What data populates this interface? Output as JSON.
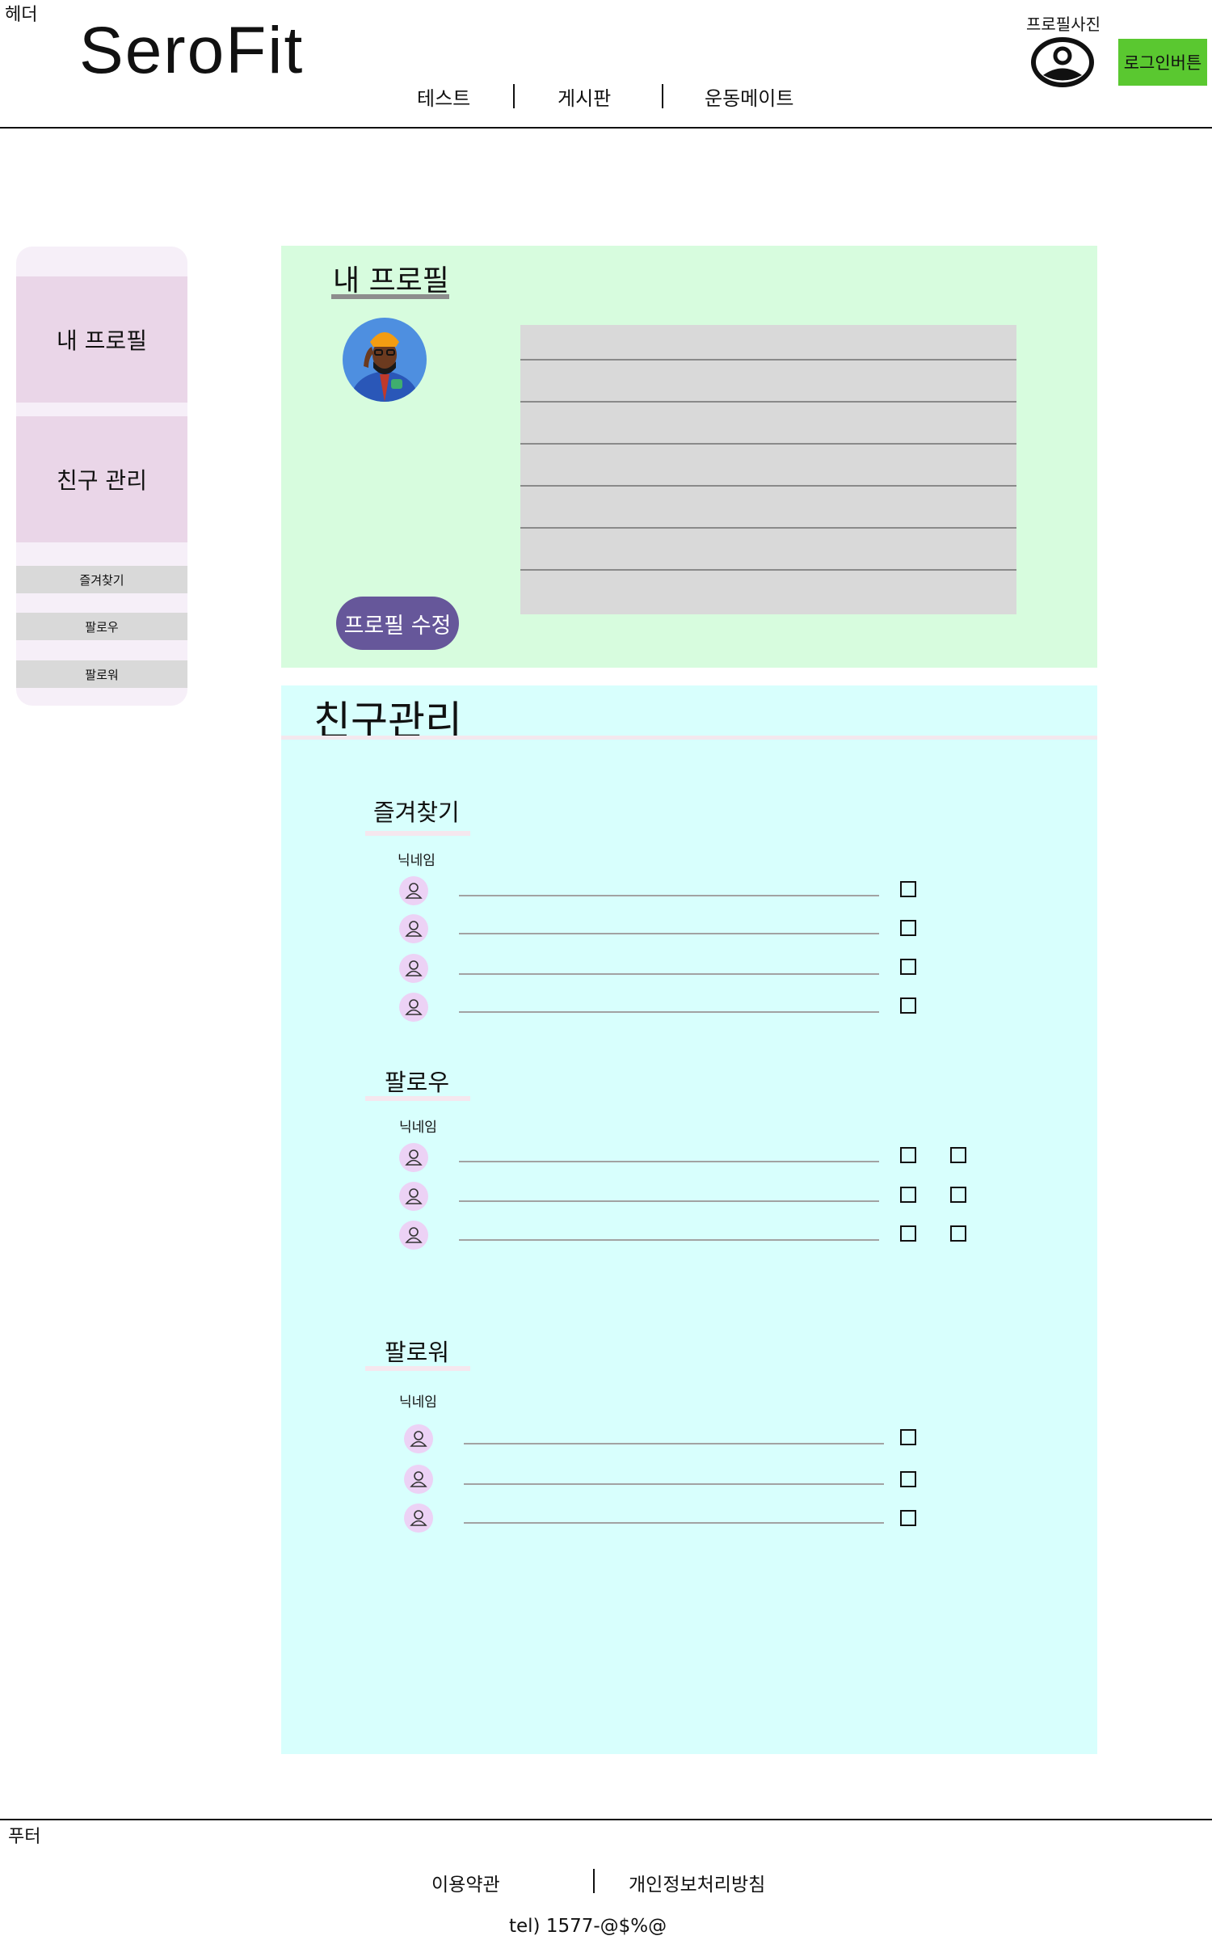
{
  "header": {
    "tag": "헤더",
    "logo": "SeroFit",
    "nav": [
      "테스트",
      "게시판",
      "운동메이트"
    ],
    "profile_photo_label": "프로필사진",
    "login_label": "로그인버튼"
  },
  "sidebar": {
    "my_profile": "내 프로필",
    "friends": "친구 관리",
    "favorites": "즐겨찾기",
    "following": "팔로우",
    "followers": "팔로워"
  },
  "profile": {
    "title": "내 프로필",
    "edit_button": "프로필 수정"
  },
  "friends": {
    "title": "친구관리",
    "favorites": {
      "title": "즐겨찾기",
      "nickname_label": "닉네임",
      "rows": 4
    },
    "following": {
      "title": "팔로우",
      "nickname_label": "닉네임",
      "rows": 3
    },
    "followers": {
      "title": "팔로워",
      "nickname_label": "닉네임",
      "rows": 3
    }
  },
  "footer": {
    "tag": "푸터",
    "terms": "이용약관",
    "privacy": "개인정보처리방침",
    "tel": "tel) 1577-@$%@"
  },
  "colors": {
    "login_button": "#5ac830",
    "profile_panel": "#d7fcde",
    "friends_panel": "#d8fffd",
    "edit_button": "#66579a",
    "sidebar_bg": "#f6eff8",
    "sidebar_item": "#ead6e8"
  },
  "icons": {
    "profile_photo": "user-circle-icon",
    "friend": "person-outline-icon"
  }
}
